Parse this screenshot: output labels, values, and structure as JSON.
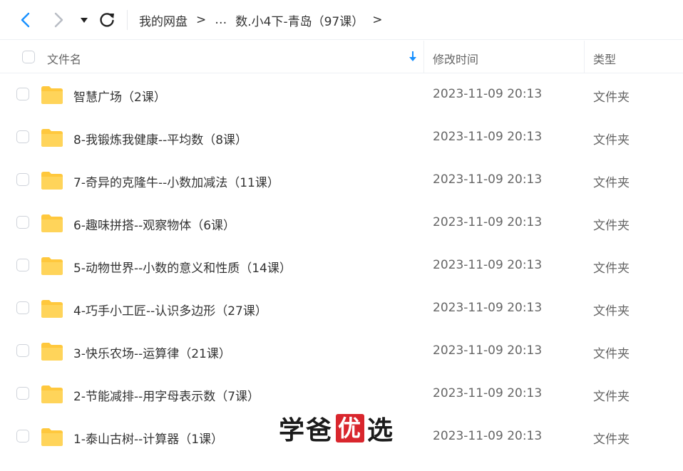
{
  "nav": {
    "breadcrumbs": [
      "我的网盘",
      "…",
      "数.小4下-青岛（97课）"
    ],
    "separator": ">"
  },
  "columns": {
    "name": "文件名",
    "time": "修改时间",
    "type": "类型"
  },
  "rows": [
    {
      "name": "智慧广场（2课）",
      "time": "2023-11-09 20:13",
      "type": "文件夹"
    },
    {
      "name": "8-我锻炼我健康--平均数（8课）",
      "time": "2023-11-09 20:13",
      "type": "文件夹"
    },
    {
      "name": "7-奇异的克隆牛--小数加减法（11课）",
      "time": "2023-11-09 20:13",
      "type": "文件夹"
    },
    {
      "name": "6-趣味拼搭--观察物体（6课）",
      "time": "2023-11-09 20:13",
      "type": "文件夹"
    },
    {
      "name": "5-动物世界--小数的意义和性质（14课）",
      "time": "2023-11-09 20:13",
      "type": "文件夹"
    },
    {
      "name": "4-巧手小工匠--认识多边形（27课）",
      "time": "2023-11-09 20:13",
      "type": "文件夹"
    },
    {
      "name": "3-快乐农场--运算律（21课）",
      "time": "2023-11-09 20:13",
      "type": "文件夹"
    },
    {
      "name": "2-节能减排--用字母表示数（7课）",
      "time": "2023-11-09 20:13",
      "type": "文件夹"
    },
    {
      "name": "1-泰山古树--计算器（1课）",
      "time": "2023-11-09 20:13",
      "type": "文件夹"
    }
  ],
  "watermark": {
    "part1": "学爸",
    "boxed": "优",
    "part2": "选"
  },
  "colors": {
    "accent": "#1890ff",
    "folder": "#ffc83d",
    "watermark_red": "#d9262d"
  }
}
